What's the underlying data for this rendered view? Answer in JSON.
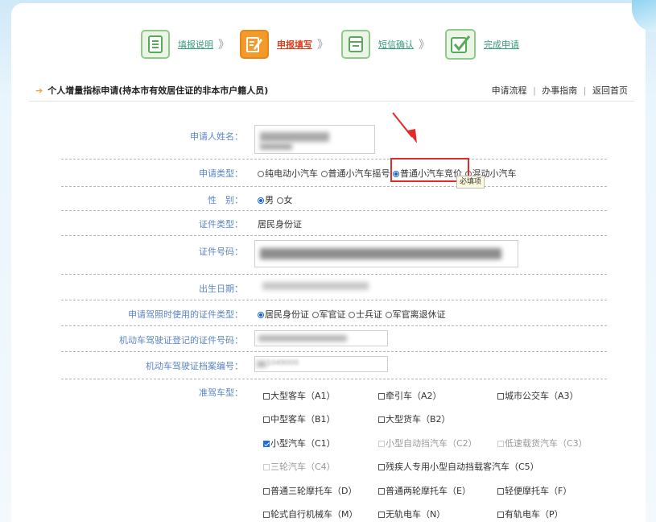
{
  "steps": [
    {
      "label": "填报说明",
      "arrow": "》",
      "active": false
    },
    {
      "label": "申报填写",
      "arrow": "》",
      "active": true
    },
    {
      "label": "短信确认",
      "arrow": "》",
      "active": false
    },
    {
      "label": "完成申请",
      "arrow": "",
      "active": false
    }
  ],
  "header": {
    "title": "个人增量指标申请(持本市有效居住证的非本市户籍人员)",
    "links": [
      "申请流程",
      "办事指南",
      "返回首页"
    ],
    "separator": "|"
  },
  "form": {
    "name_label": "申请人姓名：",
    "type_label": "申请类型：",
    "type_options": [
      "纯电动小汽车",
      "普通小汽车摇号",
      "普通小汽车竞价",
      "混动小汽车"
    ],
    "type_selected": 2,
    "required_tip": "必填项",
    "gender_label": "性　别：",
    "gender_options": [
      "男",
      "女"
    ],
    "gender_selected": 0,
    "idtype_label": "证件类型：",
    "idtype_value": "居民身份证",
    "idnum_label": "证件号码：",
    "birth_label": "出生日期：",
    "license_idtype_label": "申请驾照时使用的证件类型：",
    "license_idtype_options": [
      "居民身份证",
      "军官证",
      "士兵证",
      "军官离退休证"
    ],
    "license_idtype_selected": 0,
    "license_idnum_label": "机动车驾驶证登记的证件号码：",
    "license_file_label": "机动车驾驶证档案编号：",
    "license_file_value": "1049000",
    "class_label": "准驾车型：",
    "classes": [
      {
        "label": "大型客车（A1）",
        "checked": false,
        "disabled": false
      },
      {
        "label": "牵引车（A2）",
        "checked": false,
        "disabled": false
      },
      {
        "label": "城市公交车（A3）",
        "checked": false,
        "disabled": false
      },
      {
        "label": "中型客车（B1）",
        "checked": false,
        "disabled": false
      },
      {
        "label": "大型货车（B2）",
        "checked": false,
        "disabled": false
      },
      {
        "label": "小型汽车（C1）",
        "checked": true,
        "disabled": false
      },
      {
        "label": "小型自动挡汽车（C2）",
        "checked": false,
        "disabled": true
      },
      {
        "label": "低速载货汽车（C3）",
        "checked": false,
        "disabled": true
      },
      {
        "label": "三轮汽车（C4）",
        "checked": false,
        "disabled": true
      },
      {
        "label": "残疾人专用小型自动挡载客汽车（C5）",
        "checked": false,
        "disabled": false
      },
      {
        "label": "普通三轮摩托车（D）",
        "checked": false,
        "disabled": false
      },
      {
        "label": "普通两轮摩托车（E）",
        "checked": false,
        "disabled": false
      },
      {
        "label": "轻便摩托车（F）",
        "checked": false,
        "disabled": false
      },
      {
        "label": "轮式自行机械车（M）",
        "checked": false,
        "disabled": false
      },
      {
        "label": "无轨电车（N）",
        "checked": false,
        "disabled": false
      },
      {
        "label": "有轨电车（P）",
        "checked": false,
        "disabled": false
      }
    ]
  },
  "colors": {
    "accent": "#f39a2b",
    "step_green": "#8fca8b",
    "label_blue": "#5a86c7",
    "highlight_red": "#e22b2b"
  }
}
